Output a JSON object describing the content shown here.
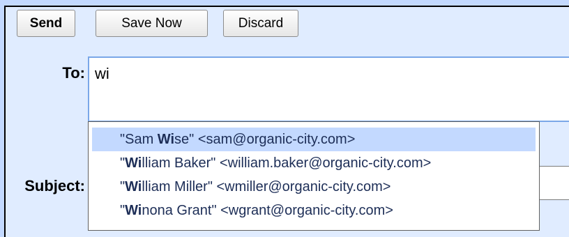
{
  "toolbar": {
    "send_label": "Send",
    "save_label": "Save Now",
    "discard_label": "Discard"
  },
  "form": {
    "to_label": "To:",
    "to_value": "wi",
    "subject_label": "Subject:",
    "subject_value": ""
  },
  "autocomplete": {
    "query": "wi",
    "selected_index": 0,
    "suggestions": [
      {
        "pre": "\"Sam ",
        "match": "Wi",
        "post": "se\" <sam@organic-city.com>"
      },
      {
        "pre": "\"",
        "match": "Wi",
        "post": "lliam Baker\" <william.baker@organic-city.com>"
      },
      {
        "pre": "\"",
        "match": "Wi",
        "post": "lliam Miller\" <wmiller@organic-city.com>"
      },
      {
        "pre": "\"",
        "match": "Wi",
        "post": "nona Grant\" <wgrant@organic-city.com>"
      }
    ]
  },
  "colors": {
    "frame": "#c3d9ff",
    "panel": "#e0ecff",
    "focus_border": "#7aa7e8",
    "selected_suggestion": "#c3d9ff",
    "suggestion_text": "#1d2e57"
  }
}
